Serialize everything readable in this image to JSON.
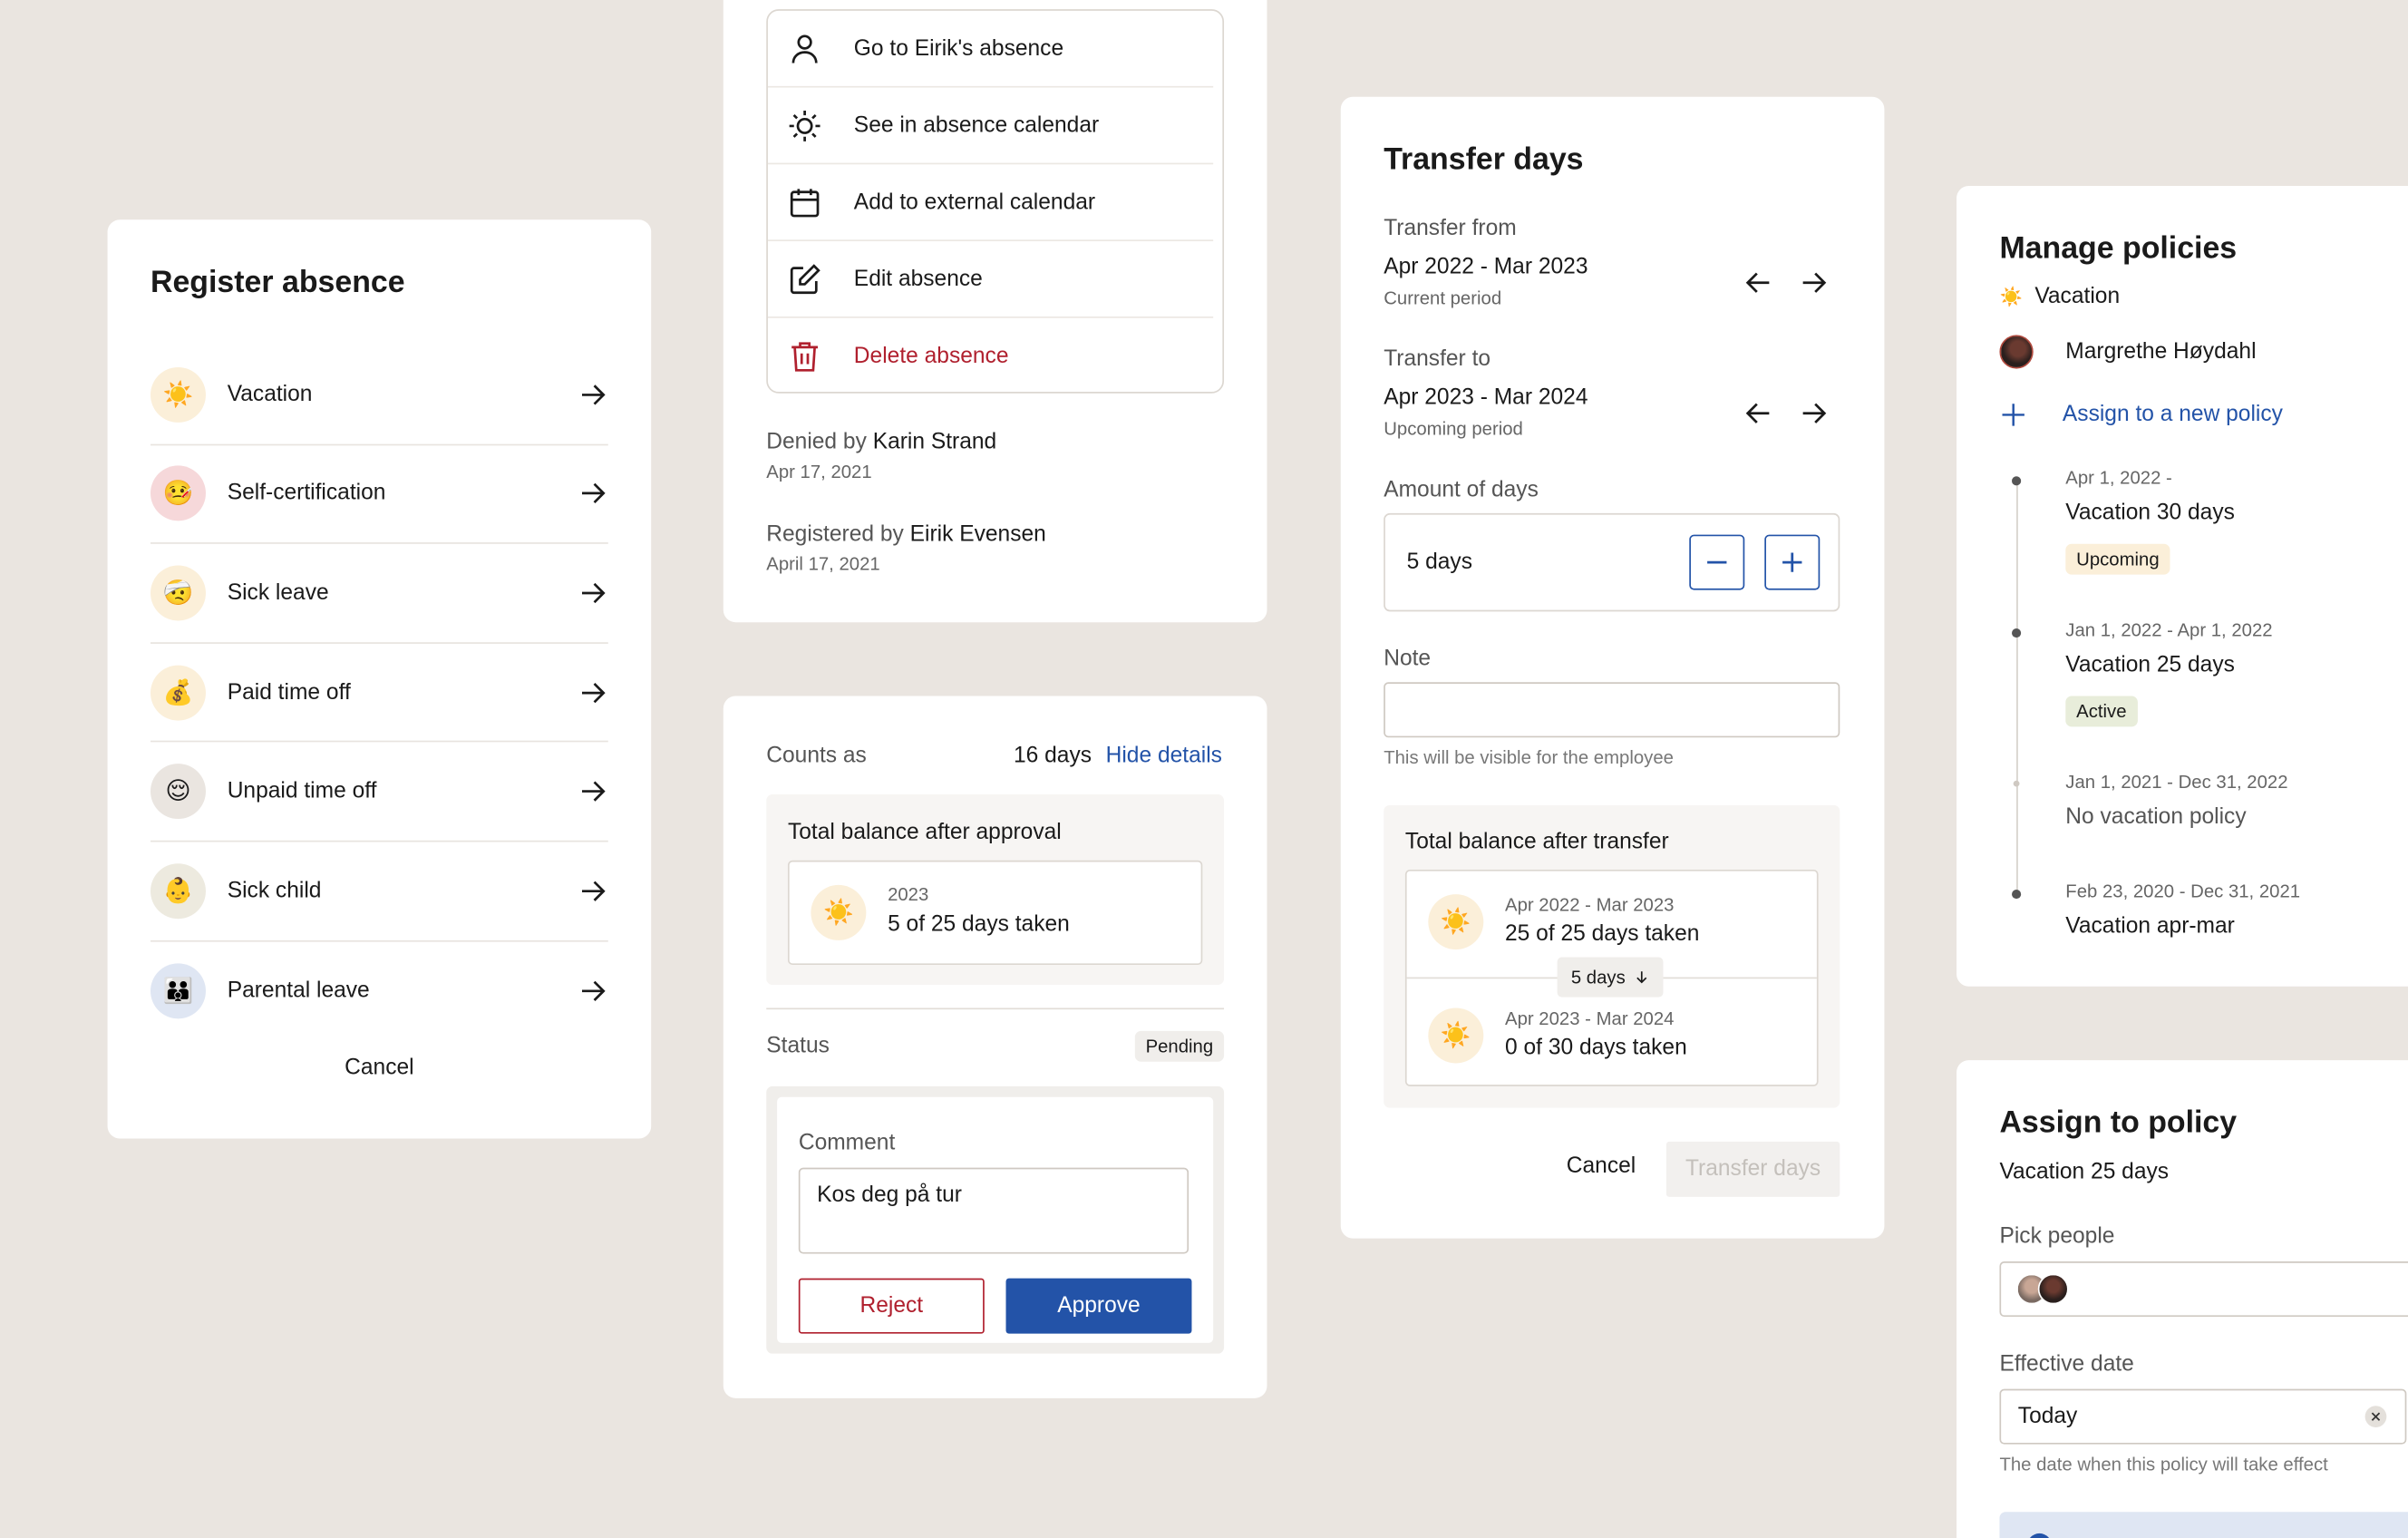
{
  "register": {
    "title": "Register absence",
    "items": [
      {
        "label": "Vacation",
        "emoji": "☀️",
        "icon": "sun-emoji-icon",
        "bg": "#FBEFD9"
      },
      {
        "label": "Self-certification",
        "emoji": "🤒",
        "icon": "sick-face-emoji-icon",
        "bg": "#F6D8DA"
      },
      {
        "label": "Sick leave",
        "emoji": "🤕",
        "icon": "bandage-face-emoji-icon",
        "bg": "#FBEFD9"
      },
      {
        "label": "Paid time off",
        "emoji": "💰",
        "icon": "money-bag-emoji-icon",
        "bg": "#FBEFD9"
      },
      {
        "label": "Unpaid time off",
        "emoji": "😌",
        "icon": "relieved-face-emoji-icon",
        "bg": "#EAE5E0"
      },
      {
        "label": "Sick child",
        "emoji": "👶",
        "icon": "baby-emoji-icon",
        "bg": "#EDEADF"
      },
      {
        "label": "Parental leave",
        "emoji": "👪",
        "icon": "family-emoji-icon",
        "bg": "#DFE6F3"
      }
    ],
    "cancel": "Cancel"
  },
  "menu": {
    "items": [
      {
        "label": "Go to Eirik's absence",
        "icon": "person-icon"
      },
      {
        "label": "See in absence calendar",
        "icon": "sun-icon"
      },
      {
        "label": "Add to external calendar",
        "icon": "calendar-icon"
      },
      {
        "label": "Edit absence",
        "icon": "edit-icon"
      },
      {
        "label": "Delete absence",
        "icon": "trash-icon"
      }
    ],
    "denied_prefix": "Denied by",
    "denied_by": "Karin Strand",
    "denied_date": "Apr 17, 2021",
    "registered_prefix": "Registered by",
    "registered_by": "Eirik Evensen",
    "registered_date": "April 17, 2021"
  },
  "detail": {
    "counts_as_label": "Counts as",
    "counts_as_value": "16 days",
    "hide_details": "Hide details",
    "balance_title": "Total balance after approval",
    "balance_year": "2023",
    "balance_taken": "5 of 25 days taken",
    "status_label": "Status",
    "status_value": "Pending",
    "comment_label": "Comment",
    "comment_value": "Kos deg på tur",
    "reject": "Reject",
    "approve": "Approve"
  },
  "transfer": {
    "title": "Transfer days",
    "from_label": "Transfer from",
    "from_period": "Apr 2022 - Mar 2023",
    "from_sub": "Current period",
    "to_label": "Transfer to",
    "to_period": "Apr 2023 - Mar 2024",
    "to_sub": "Upcoming period",
    "amount_label": "Amount of days",
    "amount_value": "5 days",
    "note_label": "Note",
    "note_value": "",
    "note_help": "This will be visible for the employee",
    "balance_title": "Total balance after transfer",
    "bal1_period": "Apr 2022 - Mar 2023",
    "bal1_taken": "25 of 25 days taken",
    "chip": "5 days",
    "bal2_period": "Apr 2023 - Mar 2024",
    "bal2_taken": "0 of 30 days taken",
    "cancel": "Cancel",
    "submit": "Transfer days"
  },
  "policies": {
    "title": "Manage policies",
    "type_emoji": "☀️",
    "type": "Vacation",
    "person": "Margrethe Høydahl",
    "assign_new": "Assign to a new policy",
    "timeline": [
      {
        "date": "Apr 1, 2022 -",
        "name": "Vacation 30 days",
        "badge": "Upcoming"
      },
      {
        "date": "Jan 1, 2022 - Apr 1, 2022",
        "name": "Vacation 25 days",
        "badge": "Active"
      },
      {
        "date": "Jan 1, 2021 - Dec 31, 2022",
        "name": "No vacation policy",
        "badge": ""
      },
      {
        "date": "Feb 23, 2020 - Dec 31, 2021",
        "name": "Vacation apr-mar",
        "badge": ""
      }
    ]
  },
  "assign": {
    "title": "Assign to policy",
    "policy": "Vacation 25 days",
    "pick_label": "Pick people",
    "date_label": "Effective date",
    "date_value": "Today",
    "date_help": "The date when this policy will take effect"
  },
  "colors": {
    "background": "#EAE5E0",
    "primary": "#2353A8",
    "danger": "#B0202E",
    "upcoming_badge": "#FBEFD9",
    "active_badge": "#E8EDDA"
  }
}
